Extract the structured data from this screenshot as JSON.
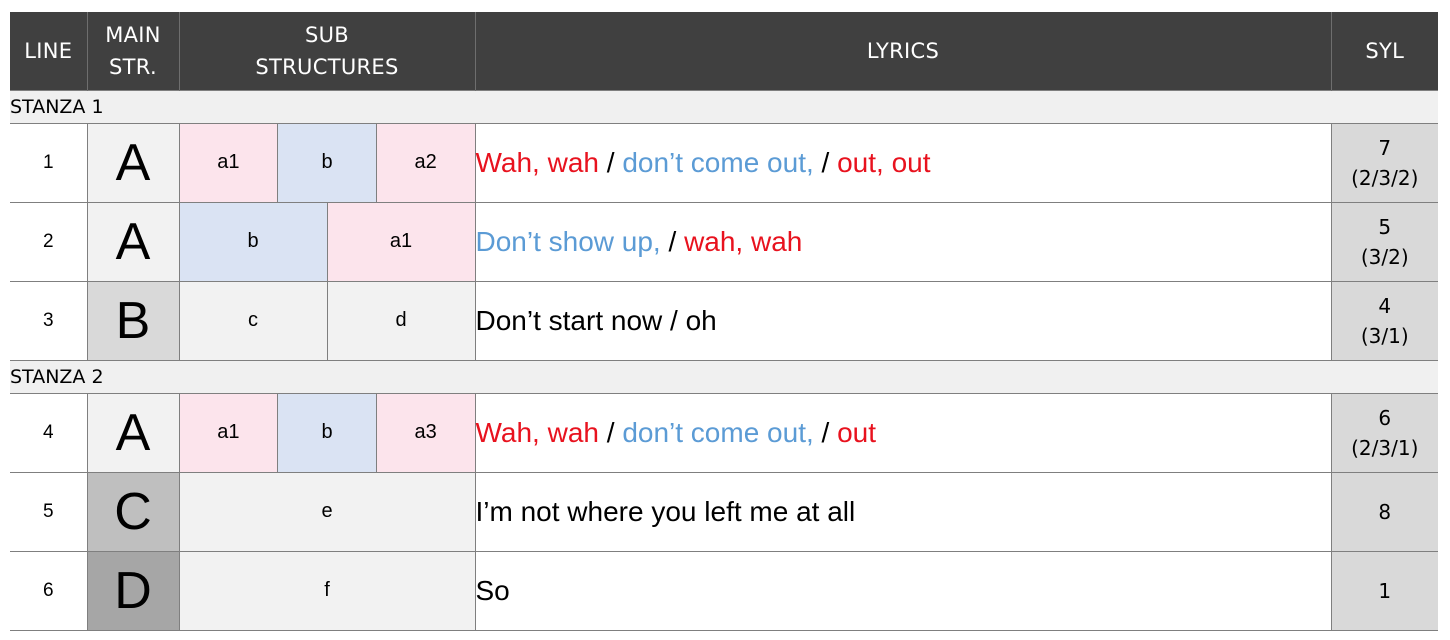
{
  "headers": {
    "line": "LINE",
    "main_line1": "MAIN",
    "main_line2": "STR.",
    "sub_line1": "SUB",
    "sub_line2": "STRUCTURES",
    "lyrics": "LYRICS",
    "syl": "SYL"
  },
  "colors": {
    "header_bg": "#404040",
    "a_part": "#fce4ec",
    "b_part": "#dae3f3",
    "neutral_part": "#f2f2f2",
    "lyric_red": "#e8121e",
    "lyric_blue": "#5b9bd5",
    "main_A": "#f2f2f2",
    "main_B": "#d9d9d9",
    "main_C": "#bfbfbf",
    "main_D": "#a6a6a6"
  },
  "stanzas": [
    {
      "label": "STANZA 1",
      "lines": [
        {
          "num": "1",
          "main": "A",
          "main_color": "#f2f2f2",
          "subs": [
            {
              "label": "a1",
              "color": "#fce4ec",
              "span": 1
            },
            {
              "label": "b",
              "color": "#dae3f3",
              "span": 1
            },
            {
              "label": "a2",
              "color": "#fce4ec",
              "span": 1
            }
          ],
          "lyrics": [
            {
              "text": "Wah, wah",
              "color": "red"
            },
            {
              "text": " / ",
              "color": "blk"
            },
            {
              "text": "don’t come out,",
              "color": "blue"
            },
            {
              "text": " / ",
              "color": "blk"
            },
            {
              "text": "out, out",
              "color": "red"
            }
          ],
          "syl_total": "7",
          "syl_detail": "(2/3/2)"
        },
        {
          "num": "2",
          "main": "A",
          "main_color": "#f2f2f2",
          "subs": [
            {
              "label": "b",
              "color": "#dae3f3",
              "span": 1.5
            },
            {
              "label": "a1",
              "color": "#fce4ec",
              "span": 1.5
            }
          ],
          "lyrics": [
            {
              "text": "Don’t show up,",
              "color": "blue"
            },
            {
              "text": " / ",
              "color": "blk"
            },
            {
              "text": "wah, wah",
              "color": "red"
            }
          ],
          "syl_total": "5",
          "syl_detail": "(3/2)"
        },
        {
          "num": "3",
          "main": "B",
          "main_color": "#d9d9d9",
          "subs": [
            {
              "label": "c",
              "color": "#f2f2f2",
              "span": 1.5
            },
            {
              "label": "d",
              "color": "#f2f2f2",
              "span": 1.5
            }
          ],
          "lyrics": [
            {
              "text": "Don’t start now / oh",
              "color": "blk"
            }
          ],
          "syl_total": "4",
          "syl_detail": "(3/1)"
        }
      ]
    },
    {
      "label": "STANZA 2",
      "lines": [
        {
          "num": "4",
          "main": "A",
          "main_color": "#f2f2f2",
          "subs": [
            {
              "label": "a1",
              "color": "#fce4ec",
              "span": 1
            },
            {
              "label": "b",
              "color": "#dae3f3",
              "span": 1
            },
            {
              "label": "a3",
              "color": "#fce4ec",
              "span": 1
            }
          ],
          "lyrics": [
            {
              "text": "Wah, wah",
              "color": "red"
            },
            {
              "text": " / ",
              "color": "blk"
            },
            {
              "text": "don’t come out,",
              "color": "blue"
            },
            {
              "text": " / ",
              "color": "blk"
            },
            {
              "text": "out",
              "color": "red"
            }
          ],
          "syl_total": "6",
          "syl_detail": "(2/3/1)"
        },
        {
          "num": "5",
          "main": "C",
          "main_color": "#bfbfbf",
          "subs": [
            {
              "label": "e",
              "color": "#f2f2f2",
              "span": 3
            }
          ],
          "lyrics": [
            {
              "text": "I’m not where you left me at all",
              "color": "blk"
            }
          ],
          "syl_total": "8",
          "syl_detail": ""
        },
        {
          "num": "6",
          "main": "D",
          "main_color": "#a6a6a6",
          "subs": [
            {
              "label": "f",
              "color": "#f2f2f2",
              "span": 3
            }
          ],
          "lyrics": [
            {
              "text": "So",
              "color": "blk"
            }
          ],
          "syl_total": "1",
          "syl_detail": ""
        }
      ]
    }
  ]
}
